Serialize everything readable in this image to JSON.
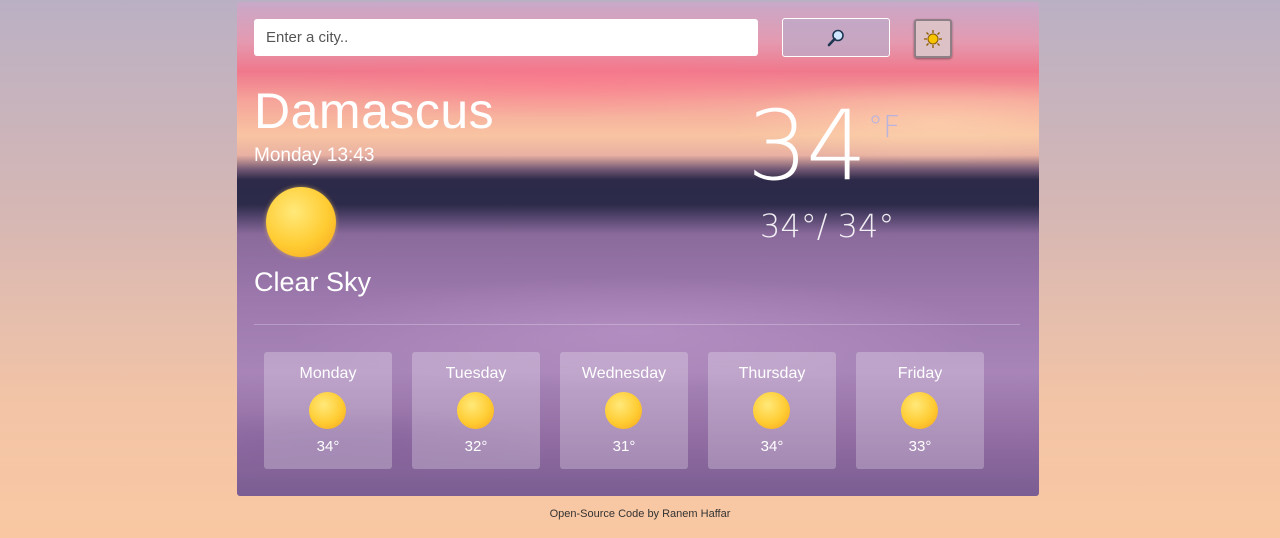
{
  "search": {
    "placeholder": "Enter a city..",
    "button_icon": "magnifier-icon"
  },
  "theme_toggle": {
    "icon": "sun-icon"
  },
  "current": {
    "city": "Damascus",
    "datetime": "Monday 13:43",
    "condition": "Clear Sky",
    "temperature": "34",
    "unit": "°F",
    "min_max": "34°/ 34°",
    "icon": "sun-icon"
  },
  "forecast": [
    {
      "day": "Monday",
      "temp": "34°",
      "icon": "sun-icon"
    },
    {
      "day": "Tuesday",
      "temp": "32°",
      "icon": "sun-icon"
    },
    {
      "day": "Wednesday",
      "temp": "31°",
      "icon": "sun-icon"
    },
    {
      "day": "Thursday",
      "temp": "34°",
      "icon": "sun-icon"
    },
    {
      "day": "Friday",
      "temp": "33°",
      "icon": "sun-icon"
    }
  ],
  "footer": {
    "text": "Open-Source Code by Ranem Haffar"
  },
  "colors": {
    "sun": "#ffcc33",
    "unit": "#b9b3dd"
  }
}
